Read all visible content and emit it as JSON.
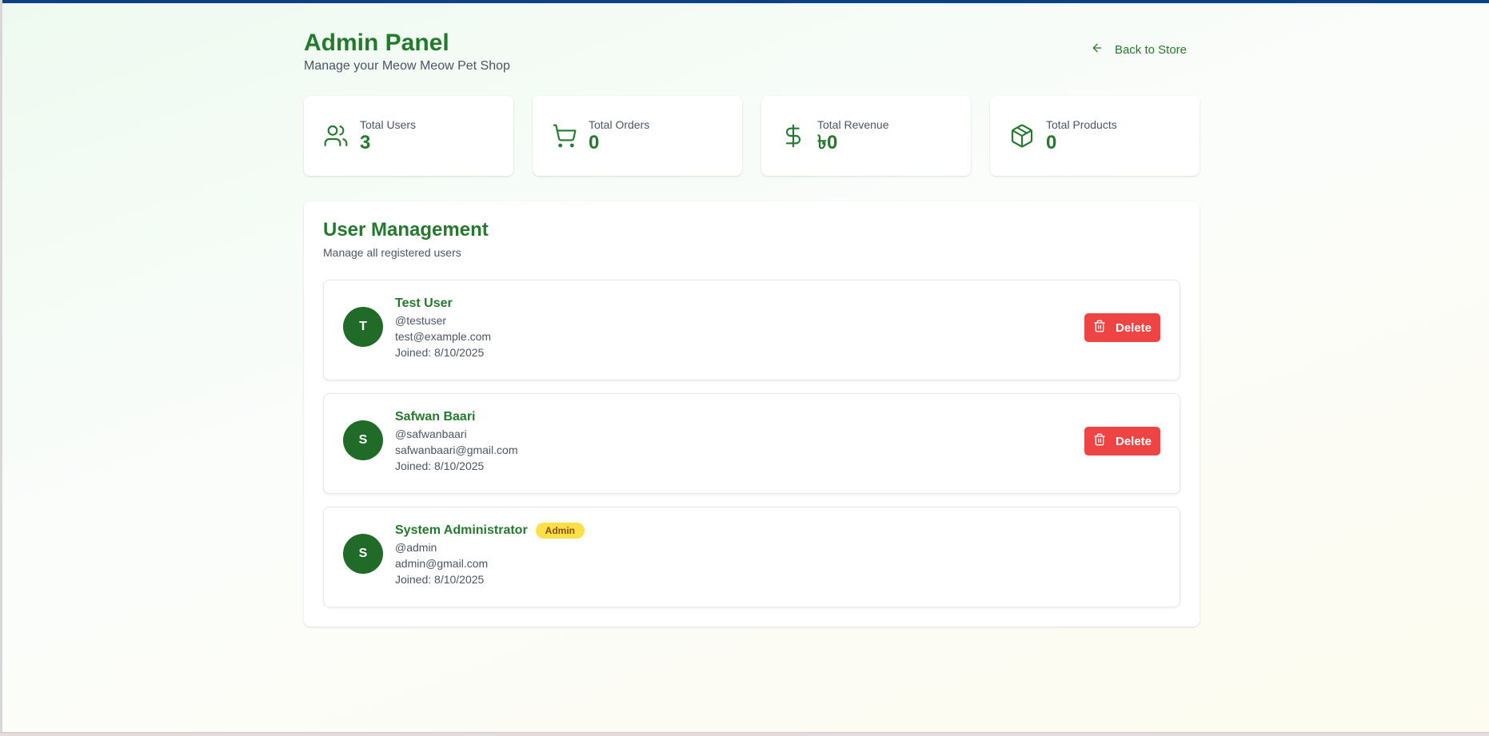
{
  "header": {
    "title": "Admin Panel",
    "subtitle": "Manage your Meow Meow Pet Shop",
    "back_label": "Back to Store"
  },
  "stats": [
    {
      "label": "Total Users",
      "value": "3",
      "icon": "users-icon"
    },
    {
      "label": "Total Orders",
      "value": "0",
      "icon": "cart-icon"
    },
    {
      "label": "Total Revenue",
      "value": "৳0",
      "icon": "dollar-icon"
    },
    {
      "label": "Total Products",
      "value": "0",
      "icon": "box-icon"
    }
  ],
  "user_management": {
    "title": "User Management",
    "subtitle": "Manage all registered users",
    "delete_label": "Delete",
    "users": [
      {
        "initial": "T",
        "name": "Test User",
        "username": "@testuser",
        "email": "test@example.com",
        "joined": "Joined: 8/10/2025",
        "badge": ""
      },
      {
        "initial": "S",
        "name": "Safwan Baari",
        "username": "@safwanbaari",
        "email": "safwanbaari@gmail.com",
        "joined": "Joined: 8/10/2025",
        "badge": ""
      },
      {
        "initial": "S",
        "name": "System Administrator",
        "username": "@admin",
        "email": "admin@gmail.com",
        "joined": "Joined: 8/10/2025",
        "badge": "Admin"
      }
    ]
  },
  "colors": {
    "brand_green": "#237a2c",
    "avatar_green": "#1f6b27",
    "delete_red": "#ef4444",
    "admin_badge": "#fde047",
    "top_bar": "#0b3f86"
  }
}
